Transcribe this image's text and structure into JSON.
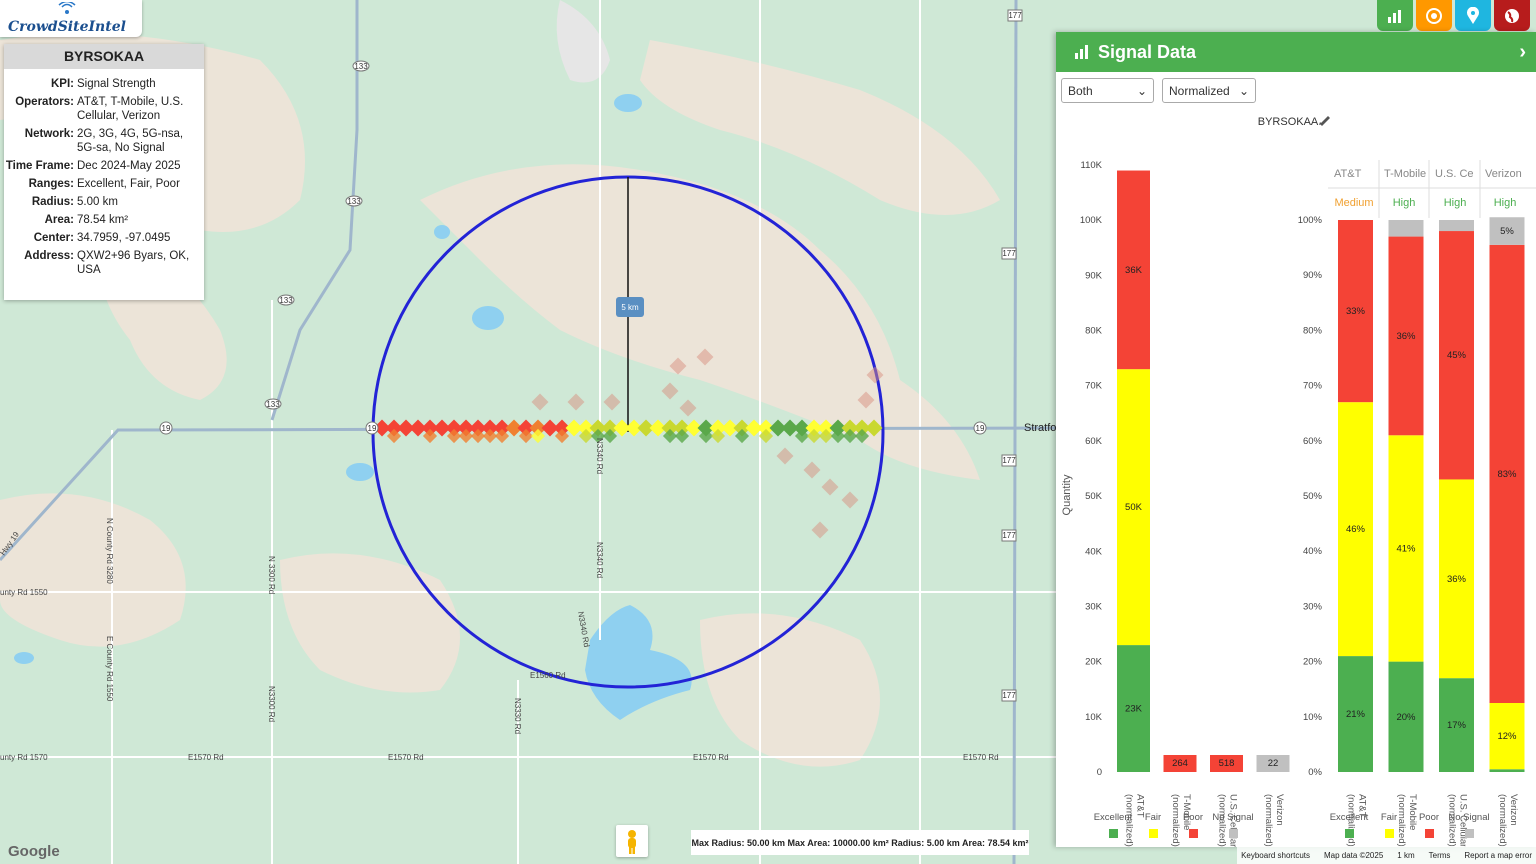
{
  "logo": {
    "text": "CrowdSiteIntel"
  },
  "info": {
    "title": "BYRSOKAA",
    "rows": [
      {
        "k": "KPI:",
        "v": "Signal Strength"
      },
      {
        "k": "Operators:",
        "v": "AT&T, T-Mobile, U.S. Cellular, Verizon"
      },
      {
        "k": "Network:",
        "v": "2G, 3G, 4G, 5G-nsa, 5G-sa, No Signal"
      },
      {
        "k": "Time Frame:",
        "v": "Dec 2024-May 2025"
      },
      {
        "k": "Ranges:",
        "v": "Excellent, Fair, Poor"
      },
      {
        "k": "Radius:",
        "v": "5.00 km"
      },
      {
        "k": "Area:",
        "v": "78.54 km²"
      },
      {
        "k": "Center:",
        "v": "34.7959, -97.0495"
      },
      {
        "k": "Address:",
        "v": "QXW2+96 Byars, OK, USA"
      }
    ]
  },
  "map": {
    "radius_marker": "5 km",
    "town_label": "Stratfo",
    "road_labels": {
      "r133a": "133",
      "r133b": "133",
      "r133c": "133",
      "r133d": "133",
      "r19a": "19",
      "r19b": "19",
      "r19c": "19",
      "r177a": "177",
      "r177b": "177",
      "r177c": "177",
      "r177d": "177",
      "r177e": "177",
      "n3340a": "N3340 Rd",
      "n3340b": "N3340 Rd",
      "n3300a": "N 3300 Rd",
      "n3300b": "N3300 Rd",
      "ncounty": "N County Rd 3280",
      "ecounty": "E County Rd 1550",
      "n3330": "N3330 Rd",
      "e1570a": "E1570 Rd",
      "e1570b": "E1570 Rd",
      "e1570c": "E1570 Rd",
      "e1570d": "E1570 Rd",
      "e1560": "E1560 Rd",
      "county1550": "unty Rd 1550",
      "county1570": "unty Rd 1570",
      "hwy19": "Hwy 19",
      "n3340c": "N3340 Rd"
    },
    "bottom_info": "Max Radius: 50.00 km  Max Area: 10000.00 km²  Radius: 5.00 km  Area: 78.54 km²",
    "google": "Google",
    "attribution": [
      "Keyboard shortcuts",
      "Map data ©2025",
      "1 km",
      "Terms",
      "Report a map error"
    ]
  },
  "panel": {
    "title": "Signal Data",
    "select1": "Both",
    "select2": "Normalized",
    "chart_title": "BYRSOKAA",
    "operator_headers": [
      "AT&T",
      "T-Mobile",
      "U.S. Ce",
      "Verizon"
    ],
    "levels": [
      "Medium",
      "High",
      "High",
      "High"
    ],
    "level_colors": [
      "#f0a030",
      "#4caf50",
      "#4caf50",
      "#4caf50"
    ],
    "legend": [
      "Excellent",
      "Fair",
      "Poor",
      "No Signal"
    ]
  },
  "chart_data": [
    {
      "type": "bar",
      "stacked": true,
      "title": "BYRSOKAA",
      "ylabel": "Quantity",
      "ylim": [
        0,
        110000
      ],
      "yticks": [
        "0",
        "10K",
        "20K",
        "30K",
        "40K",
        "50K",
        "60K",
        "70K",
        "80K",
        "90K",
        "100K",
        "110K"
      ],
      "categories": [
        "AT&T (normalized)",
        "T-Mobile (normalized)",
        "U.S. Cellular (normalized)",
        "Verizon (normalized)"
      ],
      "series": [
        {
          "name": "Excellent",
          "color": "#4caf50",
          "values": [
            23000,
            0,
            0,
            0
          ],
          "labels": [
            "23K",
            "",
            "",
            ""
          ]
        },
        {
          "name": "Fair",
          "color": "#ffff00",
          "values": [
            50000,
            0,
            0,
            0
          ],
          "labels": [
            "50K",
            "",
            "",
            ""
          ]
        },
        {
          "name": "Poor",
          "color": "#f44336",
          "values": [
            36000,
            264,
            518,
            0
          ],
          "labels": [
            "36K",
            "264",
            "518",
            ""
          ]
        },
        {
          "name": "No Signal",
          "color": "#c0c0c0",
          "values": [
            0,
            0,
            0,
            22
          ],
          "labels": [
            "",
            "",
            "",
            "22"
          ]
        }
      ]
    },
    {
      "type": "bar",
      "stacked": true,
      "ylim": [
        0,
        100
      ],
      "yticks": [
        "0%",
        "10%",
        "20%",
        "30%",
        "40%",
        "50%",
        "60%",
        "70%",
        "80%",
        "90%",
        "100%"
      ],
      "categories": [
        "AT&T (normalized)",
        "T-Mobile (normalized)",
        "U.S. Cellular (normalized)",
        "Verizon (normalized)"
      ],
      "series": [
        {
          "name": "Excellent",
          "color": "#4caf50",
          "values": [
            21,
            20,
            17,
            0.5
          ],
          "labels": [
            "21%",
            "20%",
            "17%",
            ""
          ]
        },
        {
          "name": "Fair",
          "color": "#ffff00",
          "values": [
            46,
            41,
            36,
            12
          ],
          "labels": [
            "46%",
            "41%",
            "36%",
            "12%"
          ]
        },
        {
          "name": "Poor",
          "color": "#f44336",
          "values": [
            33,
            36,
            45,
            83
          ],
          "labels": [
            "33%",
            "36%",
            "45%",
            "83%"
          ]
        },
        {
          "name": "No Signal",
          "color": "#c0c0c0",
          "values": [
            0,
            3,
            2,
            5
          ],
          "labels": [
            "",
            "",
            "",
            "5%"
          ]
        }
      ]
    }
  ]
}
